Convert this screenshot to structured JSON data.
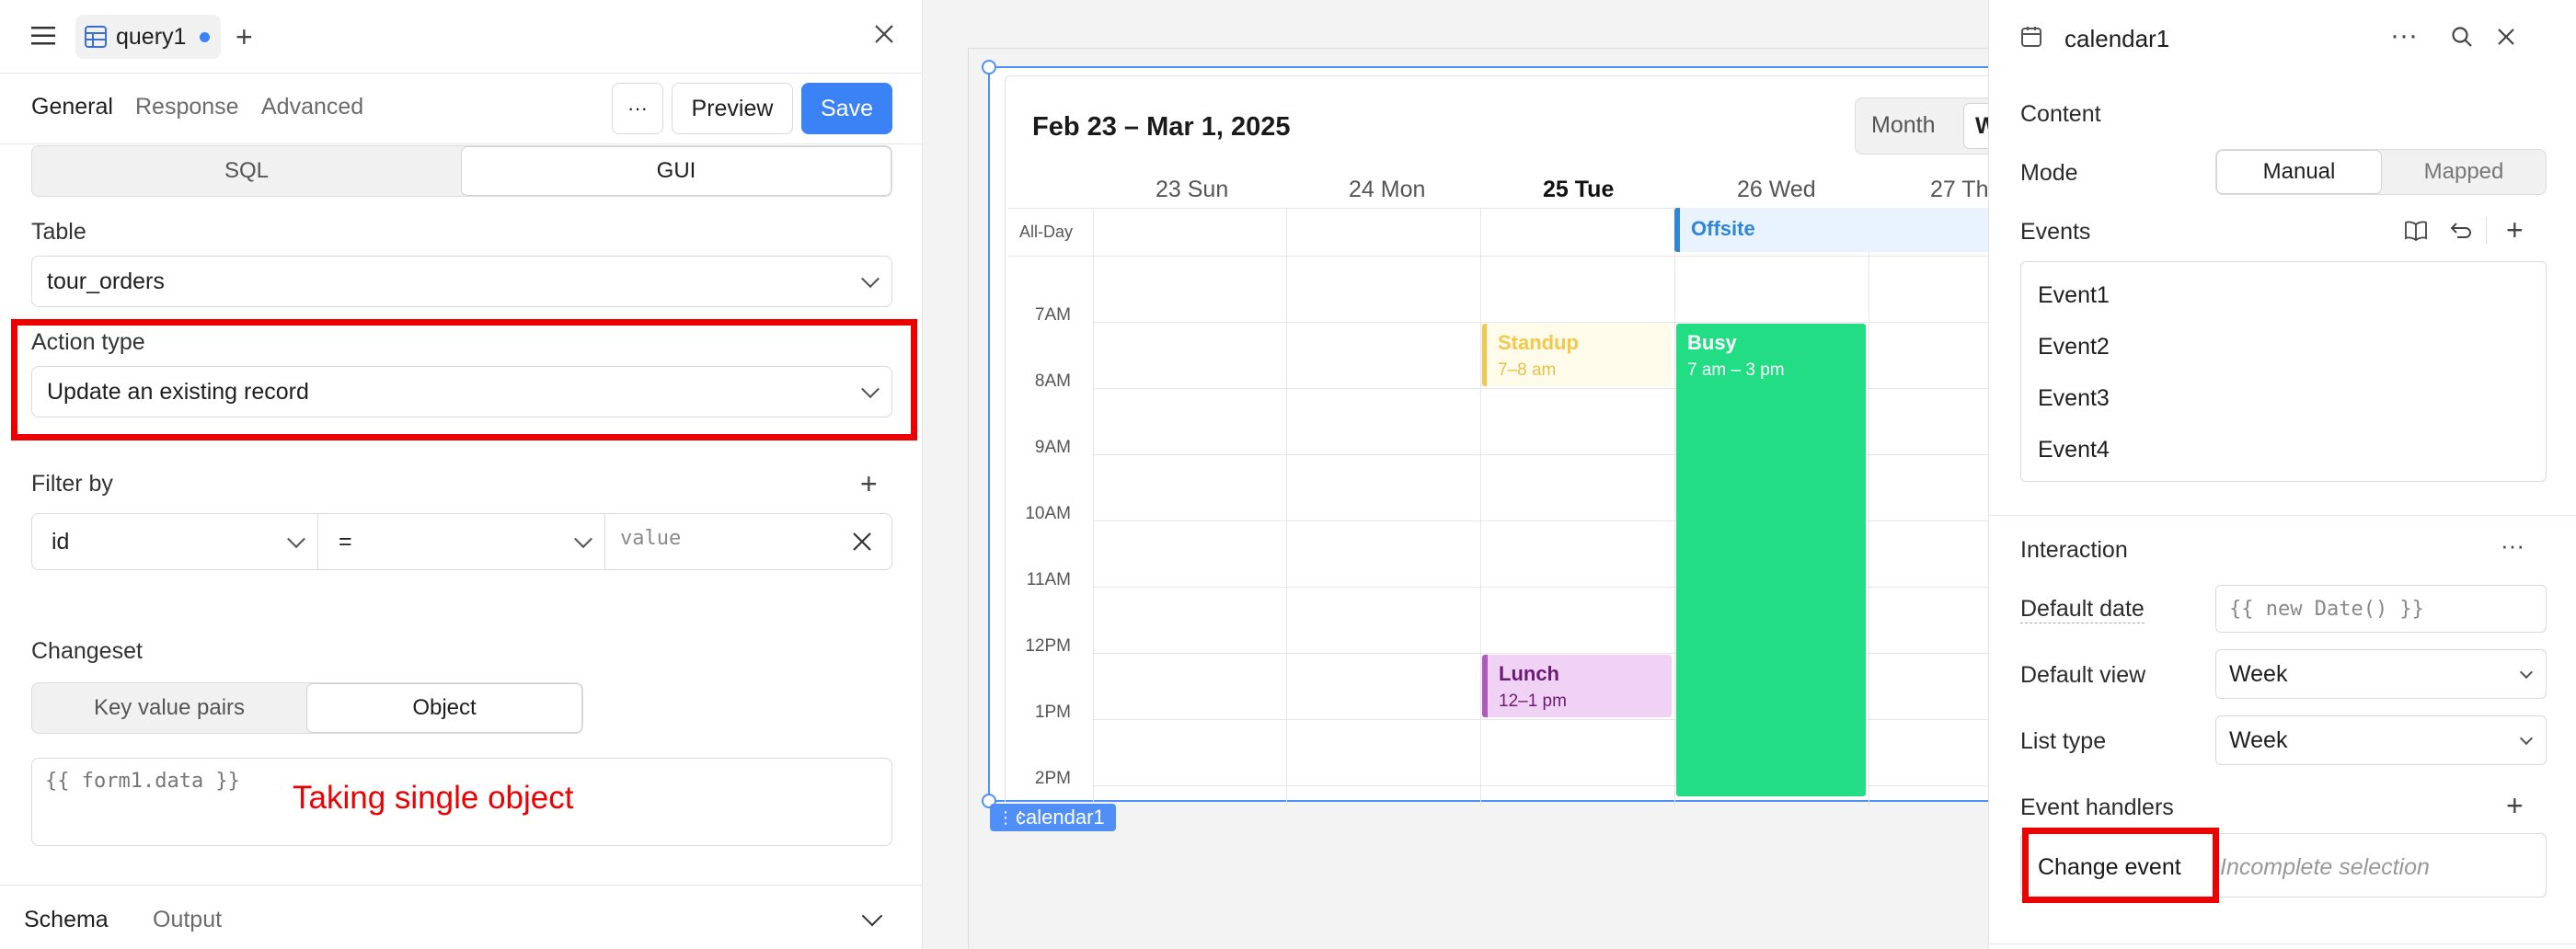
{
  "left": {
    "query_name": "query1",
    "tabs": [
      "General",
      "Response",
      "Advanced"
    ],
    "more_label": "···",
    "preview_label": "Preview",
    "save_label": "Save",
    "mode_options": [
      "SQL",
      "GUI"
    ],
    "table_label": "Table",
    "table_value": "tour_orders",
    "action_type_label": "Action type",
    "action_type_value": "Update an existing record",
    "filter_label": "Filter by",
    "filter_field": "id",
    "filter_op": "=",
    "filter_value_placeholder": "value",
    "changeset_label": "Changeset",
    "changeset_options": [
      "Key value pairs",
      "Object"
    ],
    "changeset_value": "{{ form1.data }}",
    "annotation": "Taking single object",
    "bottom_tabs": [
      "Schema",
      "Output"
    ]
  },
  "calendar": {
    "range_title": "Feb 23 – Mar 1, 2025",
    "view_month": "Month",
    "view_week_partial": "W",
    "days": [
      "23 Sun",
      "24 Mon",
      "25 Tue",
      "26 Wed",
      "27 Th"
    ],
    "all_day_label": "All-Day",
    "times": [
      "7AM",
      "8AM",
      "9AM",
      "10AM",
      "11AM",
      "12PM",
      "1PM",
      "2PM"
    ],
    "events": {
      "offsite": {
        "title": "Offsite"
      },
      "standup": {
        "title": "Standup",
        "time": "7–8 am"
      },
      "busy": {
        "title": "Busy",
        "time": "7 am – 3 pm"
      },
      "lunch": {
        "title": "Lunch",
        "time": "12–1 pm"
      }
    },
    "component_tag": "calendar1"
  },
  "right": {
    "component_name": "calendar1",
    "content_label": "Content",
    "mode_label": "Mode",
    "mode_options": [
      "Manual",
      "Mapped"
    ],
    "events_label": "Events",
    "event_items": [
      "Event1",
      "Event2",
      "Event3",
      "Event4"
    ],
    "interaction_label": "Interaction",
    "default_date_label": "Default date",
    "default_date_value": "{{ new Date() }}",
    "default_view_label": "Default view",
    "default_view_value": "Week",
    "list_type_label": "List type",
    "list_type_value": "Week",
    "event_handlers_label": "Event handlers",
    "change_event_label": "Change event",
    "change_event_value": "Incomplete selection"
  },
  "colors": {
    "accent": "#3b82f6",
    "highlight": "#ee0000",
    "busy": "#22dd84",
    "standup_bg": "#fffbea",
    "standup_fg": "#f2c94c",
    "lunch_bg": "#f0d3f4",
    "lunch_fg": "#6b1a75",
    "offsite_bg": "#e8f3fd",
    "offsite_fg": "#2f86d6"
  }
}
